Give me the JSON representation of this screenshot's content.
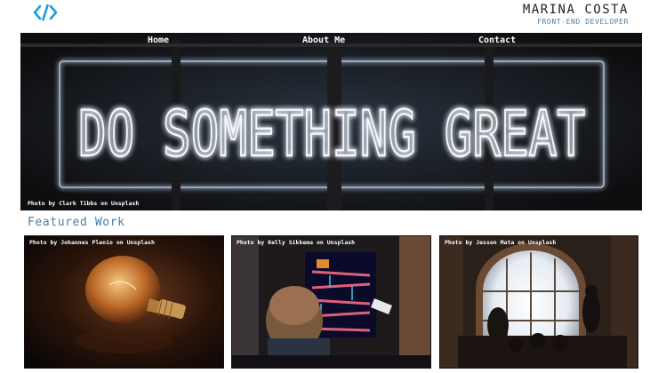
{
  "brand": {
    "name": "MARINA COSTA",
    "role": "FRONT-END DEVELOPER",
    "logo_icon": "code-brackets-icon"
  },
  "nav": {
    "home": "Home",
    "about": "About Me",
    "contact": "Contact"
  },
  "hero": {
    "image_credit": "Photo by Clark Tibbs on Unsplash",
    "neon_text": "DO SOMETHING GREAT"
  },
  "featured": {
    "title": "Featured Work",
    "cards": [
      {
        "credit": "Photo by Johannes Plenio on Unsplash"
      },
      {
        "credit": "Photo by Kelly Sikkema on Unsplash"
      },
      {
        "credit": "Photo by Jesson Mata on Unsplash"
      }
    ]
  },
  "colors": {
    "accent": "#4a7fa3",
    "logo": "#1aa0d8",
    "hero_bg": "#141416",
    "neon": "#eef6ff"
  }
}
